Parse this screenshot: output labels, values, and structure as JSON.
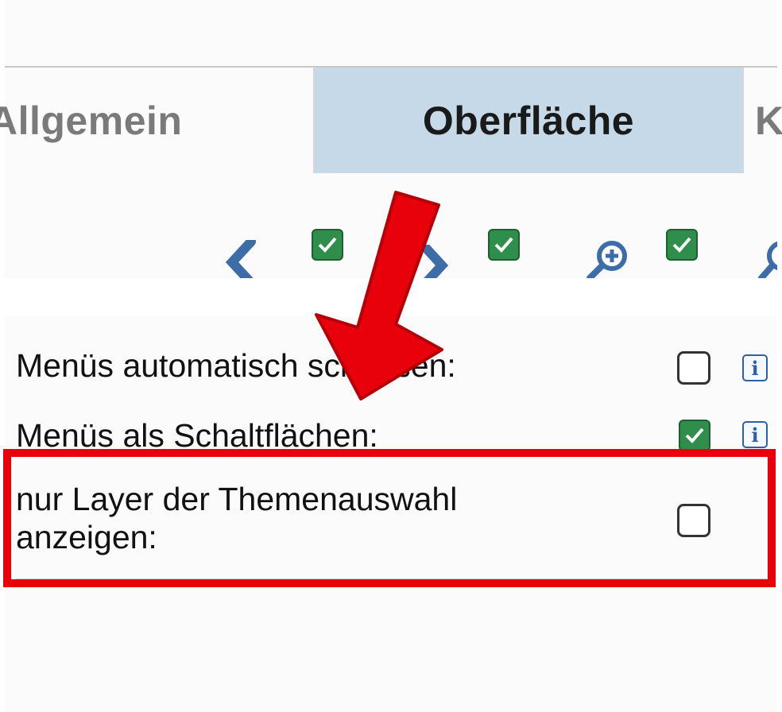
{
  "tabs": {
    "allgemein": "Allgemein",
    "oberflaeche": "Oberfläche",
    "next_partial": "K"
  },
  "toolbar": {
    "icons": [
      "chevron-left-icon",
      "chevron-right-icon",
      "zoom-in-icon",
      "zoom-out-icon"
    ],
    "checkbox_states": [
      true,
      true,
      true
    ]
  },
  "settings": {
    "rows": [
      {
        "label": "Menüs automatisch schließen:",
        "checked": false
      },
      {
        "label": "Menüs als Schaltflächen:",
        "checked": true
      },
      {
        "label_line1": "nur Layer der Themenauswahl",
        "label_line2": "anzeigen:",
        "checked": false
      }
    ]
  },
  "colors": {
    "active_tab": "#c6d9e8",
    "checkbox_green": "#2f8e4b",
    "annotation_red": "#e8000b",
    "info_blue": "#2f5fa8"
  }
}
